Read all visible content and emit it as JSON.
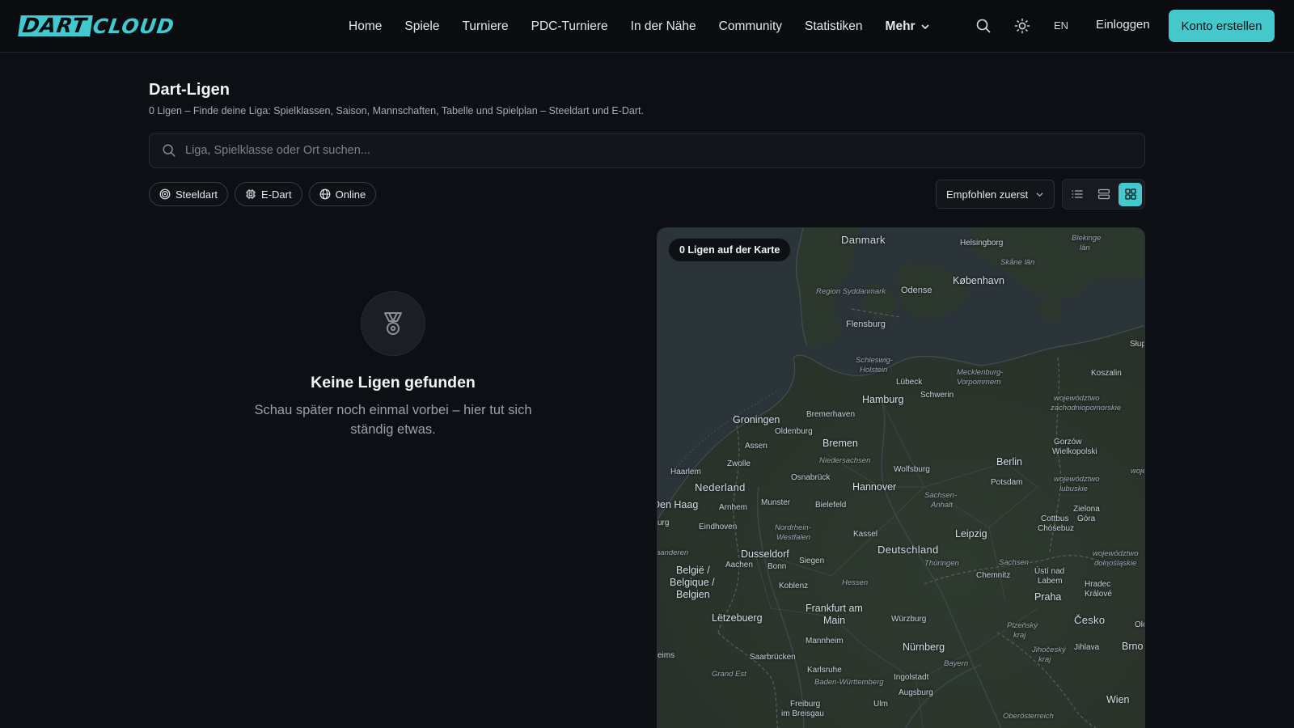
{
  "header": {
    "logo_part1": "DART",
    "logo_part2": "CLOUD",
    "nav": [
      {
        "label": "Home"
      },
      {
        "label": "Spiele"
      },
      {
        "label": "Turniere"
      },
      {
        "label": "PDC-Turniere"
      },
      {
        "label": "In der Nähe"
      },
      {
        "label": "Community"
      },
      {
        "label": "Statistiken"
      },
      {
        "label": "Mehr"
      }
    ],
    "lang": "EN",
    "login": "Einloggen",
    "signup": "Konto erstellen",
    "icons": {
      "search": "search-icon",
      "theme": "sun-icon",
      "more": "chevron-down-icon"
    }
  },
  "page": {
    "title": "Dart-Ligen",
    "subtitle": "0 Ligen – Finde deine Liga: Spielklassen, Saison, Mannschaften, Tabelle und Spielplan – Steeldart und E-Dart.",
    "search_placeholder": "Liga, Spielklasse oder Ort suchen...",
    "filters": [
      {
        "label": "Steeldart",
        "icon": "target-icon"
      },
      {
        "label": "E-Dart",
        "icon": "chip-icon"
      },
      {
        "label": "Online",
        "icon": "globe-icon"
      }
    ],
    "sort_label": "Empfohlen zuerst",
    "view_modes": [
      "list",
      "compact",
      "grid"
    ],
    "active_view": "grid"
  },
  "empty": {
    "title": "Keine Ligen gefunden",
    "text": "Schau später noch einmal vorbei – hier tut sich ständig etwas.",
    "icon": "medal-icon"
  },
  "map": {
    "badge": "0 Ligen auf der Karte",
    "labels": {
      "danmark": "Danmark",
      "helsingborg": "Helsingborg",
      "blekinge": "Blekinge",
      "blekinge2": "län",
      "skane": "Skåne län",
      "kobenhavn": "København",
      "odense": "Odense",
      "syddanmark": "Region Syddanmark",
      "flensburg": "Flensburg",
      "slup": "Słup",
      "sh1": "Schleswig-",
      "sh2": "Holstein",
      "mv1": "Mecklenburg-",
      "mv2": "Vorpommern",
      "koszalin": "Koszalin",
      "lubeck": "Lübeck",
      "schwerin": "Schwerin",
      "hamburg": "Hamburg",
      "zp1": "województwo",
      "zp2": "zachodniopomorskie",
      "bremerhaven": "Bremerhaven",
      "groningen": "Groningen",
      "oldenburg": "Oldenburg",
      "assen": "Assen",
      "bremen": "Bremen",
      "gw1": "Gorzów",
      "gw2": "Wielkopolski",
      "niedersachsen": "Niedersachsen",
      "berlin": "Berlin",
      "zwolle": "Zwolle",
      "wolfsburg": "Wolfsburg",
      "haarlem": "Haarlem",
      "osnabruck": "Osnabrück",
      "potsdam": "Potsdam",
      "woj": "wojé",
      "nederland": "Nederland",
      "hannover": "Hannover",
      "lb1": "województwo",
      "lb2": "lubuskie",
      "denhaag": "Den Haag",
      "arnhem": "Arnhem",
      "munster": "Munster",
      "bielefeld": "Bielefeld",
      "sa1": "Sachsen-",
      "sa2": "Anhalt",
      "zg1": "Zielona",
      "zg2": "Góra",
      "burg": "urg",
      "eindhoven": "Eindhoven",
      "nrw1": "Nordrhein-",
      "nrw2": "Westfalen",
      "cottbus1": "Cottbus",
      "cottbus2": "Chóśebuz",
      "kassel": "Kassel",
      "leipzig": "Leipzig",
      "vlaanderen": "aanderen",
      "dusseldorf": "Dusseldorf",
      "deutschland": "Deutschland",
      "ds1": "województwo",
      "ds2": "dolnośląskie",
      "aachen": "Aachen",
      "bonn": "Bonn",
      "siegen": "Siegen",
      "thuringen": "Thüringen",
      "sachsen": "Sachsen",
      "belgie1": "België /",
      "belgie2": "Belgique /",
      "belgie3": "Belgien",
      "chemnitz": "Chemnitz",
      "ustinad1": "Ústí nad",
      "ustinad2": "Labem",
      "koblenz": "Koblenz",
      "hessen": "Hessen",
      "hk1": "Hradec",
      "hk2": "Králové",
      "praha": "Praha",
      "ffm1": "Frankfurt am",
      "ffm2": "Main",
      "letzebuerg": "Lëtzebuerg",
      "wurzburg": "Würzburg",
      "cesko": "Česko",
      "olo": "Olo",
      "pk1": "Plzeňský",
      "pk2": "kraj",
      "mannheim": "Mannheim",
      "nurnberg": "Nürnberg",
      "jihlava": "Jihlava",
      "brno": "Brno",
      "reims": "eims",
      "saarbrucken": "Saarbrücken",
      "jk1": "Jihočeský",
      "jk2": "kraj",
      "bayern": "Bayern",
      "karlsruhe": "Karlsruhe",
      "grandest": "Grand Est",
      "ingolstadt": "Ingolstadt",
      "bw": "Baden-Württemberg",
      "augsburg": "Augsburg",
      "wien": "Wien",
      "freiburg1": "Freiburg",
      "freiburg2": "im Breisgau",
      "ulm": "Ulm",
      "oberosterreich": "Oberösterreich"
    }
  },
  "colors": {
    "accent": "#44c8cc",
    "background": "#0c0f13"
  }
}
